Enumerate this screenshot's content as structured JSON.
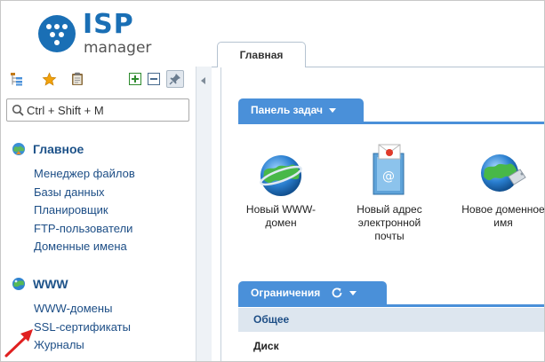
{
  "logo": {
    "brand": "ISP",
    "sub": "manager"
  },
  "search": {
    "placeholder": "Ctrl + Shift + M"
  },
  "sidebar": {
    "sections": [
      {
        "title": "Главное",
        "items": [
          "Менеджер файлов",
          "Базы данных",
          "Планировщик",
          "FTP-пользователи",
          "Доменные имена"
        ]
      },
      {
        "title": "WWW",
        "items": [
          "WWW-домены",
          "SSL-сертификаты",
          "Журналы"
        ]
      }
    ]
  },
  "tabs": [
    {
      "label": "Главная"
    }
  ],
  "task_panel": {
    "title": "Панель задач",
    "tasks": [
      {
        "label": "Новый WWW-домен",
        "icon": "globe-icon"
      },
      {
        "label": "Новый адрес электронной почты",
        "icon": "mail-address-icon"
      },
      {
        "label": "Новое доменное имя",
        "icon": "globe-tag-icon"
      }
    ]
  },
  "limits_panel": {
    "title": "Ограничения",
    "group": "Общее",
    "rows": [
      "Диск"
    ]
  },
  "colors": {
    "brand": "#1a6fb5",
    "panel_header": "#4a90d9",
    "link": "#1d4e86",
    "annotation_arrow": "#e02020"
  }
}
